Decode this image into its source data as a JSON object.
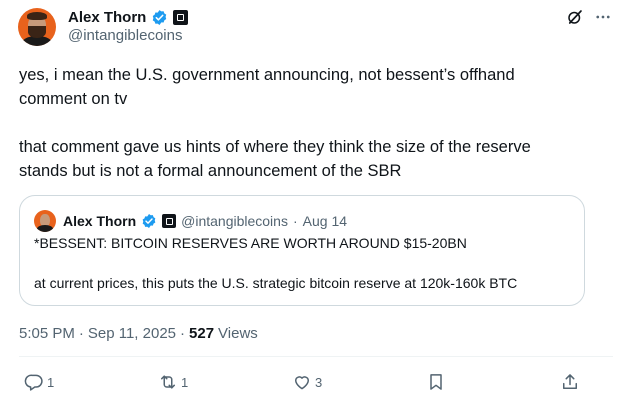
{
  "author": {
    "display_name": "Alex Thorn",
    "handle": "@intangiblecoins"
  },
  "icons": {
    "verified": "verified-badge-icon",
    "affiliation": "affiliation-badge-icon",
    "grok": "grok-icon",
    "more": "more-icon"
  },
  "body": {
    "paragraph1": "yes, i mean the U.S. government announcing, not bessent’s offhand comment on tv",
    "paragraph2": "that comment gave us hints of where they think the size of the reserve stands but is not a formal announcement of the SBR"
  },
  "quote": {
    "display_name": "Alex Thorn",
    "handle": "@intangiblecoins",
    "separator": "·",
    "date": "Aug 14",
    "line1": "*BESSENT: BITCOIN RESERVES ARE WORTH AROUND $15-20BN",
    "line2": "at current prices, this puts the U.S. strategic bitcoin reserve at 120k-160k BTC"
  },
  "meta": {
    "time": "5:05 PM",
    "date": "Sep 11, 2025",
    "separator": "·",
    "views_count": "527",
    "views_label": "Views"
  },
  "actions": {
    "replies": "1",
    "reposts": "1",
    "likes": "3"
  },
  "colors": {
    "text": "#0f1419",
    "secondary": "#536471",
    "verified": "#1d9bf0",
    "border": "#cfd9de"
  }
}
